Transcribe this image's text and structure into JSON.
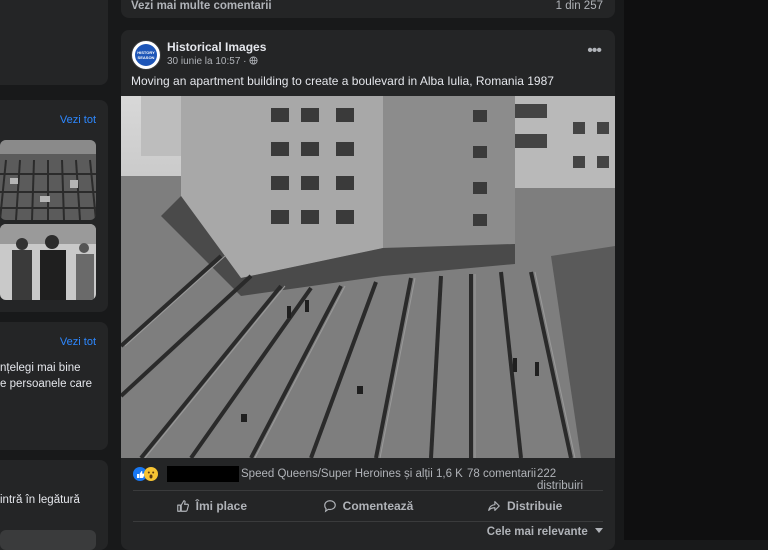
{
  "top_bar": {
    "more_comments": "Vezi mai multe comentarii",
    "counter": "1 din 257"
  },
  "left": {
    "card2": {
      "see_all": "Vezi tot"
    },
    "card3": {
      "see_all": "Vezi tot",
      "line1": "nțelegi mai bine",
      "line2": "e persoanele care"
    },
    "card4": {
      "line1": "intră în legătură"
    }
  },
  "post": {
    "page_name": "Historical Images",
    "avatar_text_1": "HISTORY",
    "avatar_text_2": "SEASON",
    "date": "30 iunie la 10:57 ·",
    "globe_icon": "globe-icon",
    "caption": "Moving an apartment building to create a boulevard in Alba Iulia, Romania 1987",
    "reactions_text": "Speed Queens/Super Heroines și alții 1,6 K",
    "comments": "78 comentarii",
    "shares": "222 distribuiri",
    "like_label": "Îmi place",
    "comment_label": "Comentează",
    "share_label": "Distribuie",
    "sort_label": "Cele mai relevante"
  },
  "colors": {
    "accent": "#2d88ff",
    "card": "#242526",
    "bg": "#18191a"
  }
}
